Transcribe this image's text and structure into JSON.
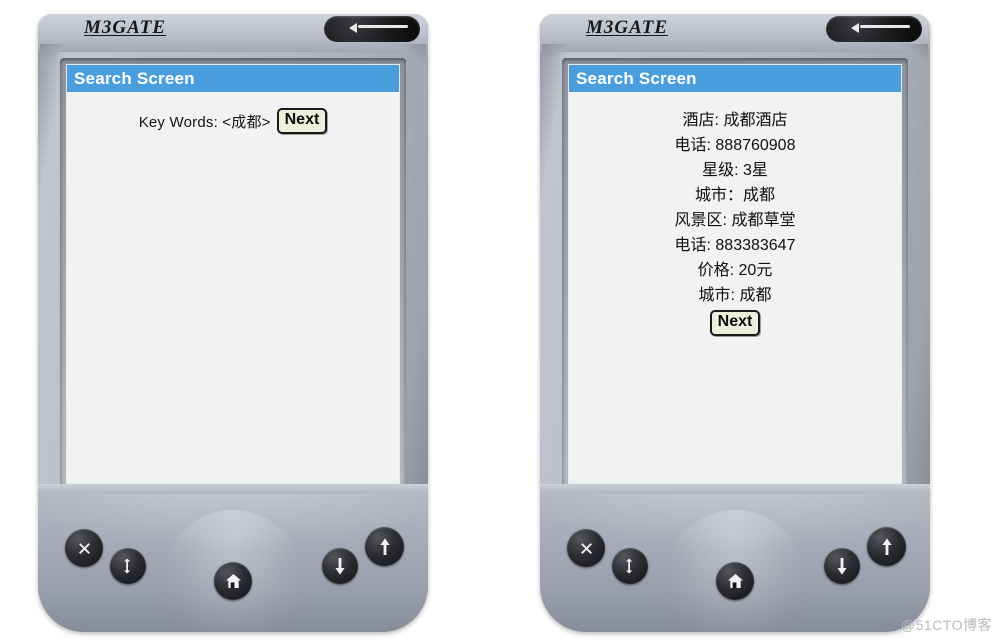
{
  "page": {
    "watermark": "@51CTO博客"
  },
  "devices": [
    {
      "id": "left",
      "brand": "M3GATE",
      "screen": {
        "title": "Search Screen",
        "keywords_label": "Key Words: <成都>",
        "next_label": "Next"
      },
      "keys": [
        {
          "name": "close-key",
          "icon": "x-icon"
        },
        {
          "name": "sync-key",
          "icon": "sync-arrows-icon"
        },
        {
          "name": "home-key",
          "icon": "home-icon"
        },
        {
          "name": "down-key",
          "icon": "arrow-down-icon"
        },
        {
          "name": "up-key",
          "icon": "arrow-up-icon"
        }
      ]
    },
    {
      "id": "right",
      "brand": "M3GATE",
      "screen": {
        "title": "Search Screen",
        "result_lines": [
          "酒店: 成都酒店",
          "电话: 888760908",
          "星级: 3星",
          "城市：成都",
          "风景区: 成都草堂",
          "电话: 883383647",
          "价格: 20元",
          "城市: 成都"
        ],
        "next_label": "Next"
      },
      "keys": [
        {
          "name": "close-key",
          "icon": "x-icon"
        },
        {
          "name": "sync-key",
          "icon": "sync-arrows-icon"
        },
        {
          "name": "home-key",
          "icon": "home-icon"
        },
        {
          "name": "down-key",
          "icon": "arrow-down-icon"
        },
        {
          "name": "up-key",
          "icon": "arrow-up-icon"
        }
      ]
    }
  ],
  "colors": {
    "title_bar": "#4a9ede",
    "screen_bg": "#f2f2f2",
    "button_face": "#eeeedc",
    "case": "#b4b8c2"
  }
}
